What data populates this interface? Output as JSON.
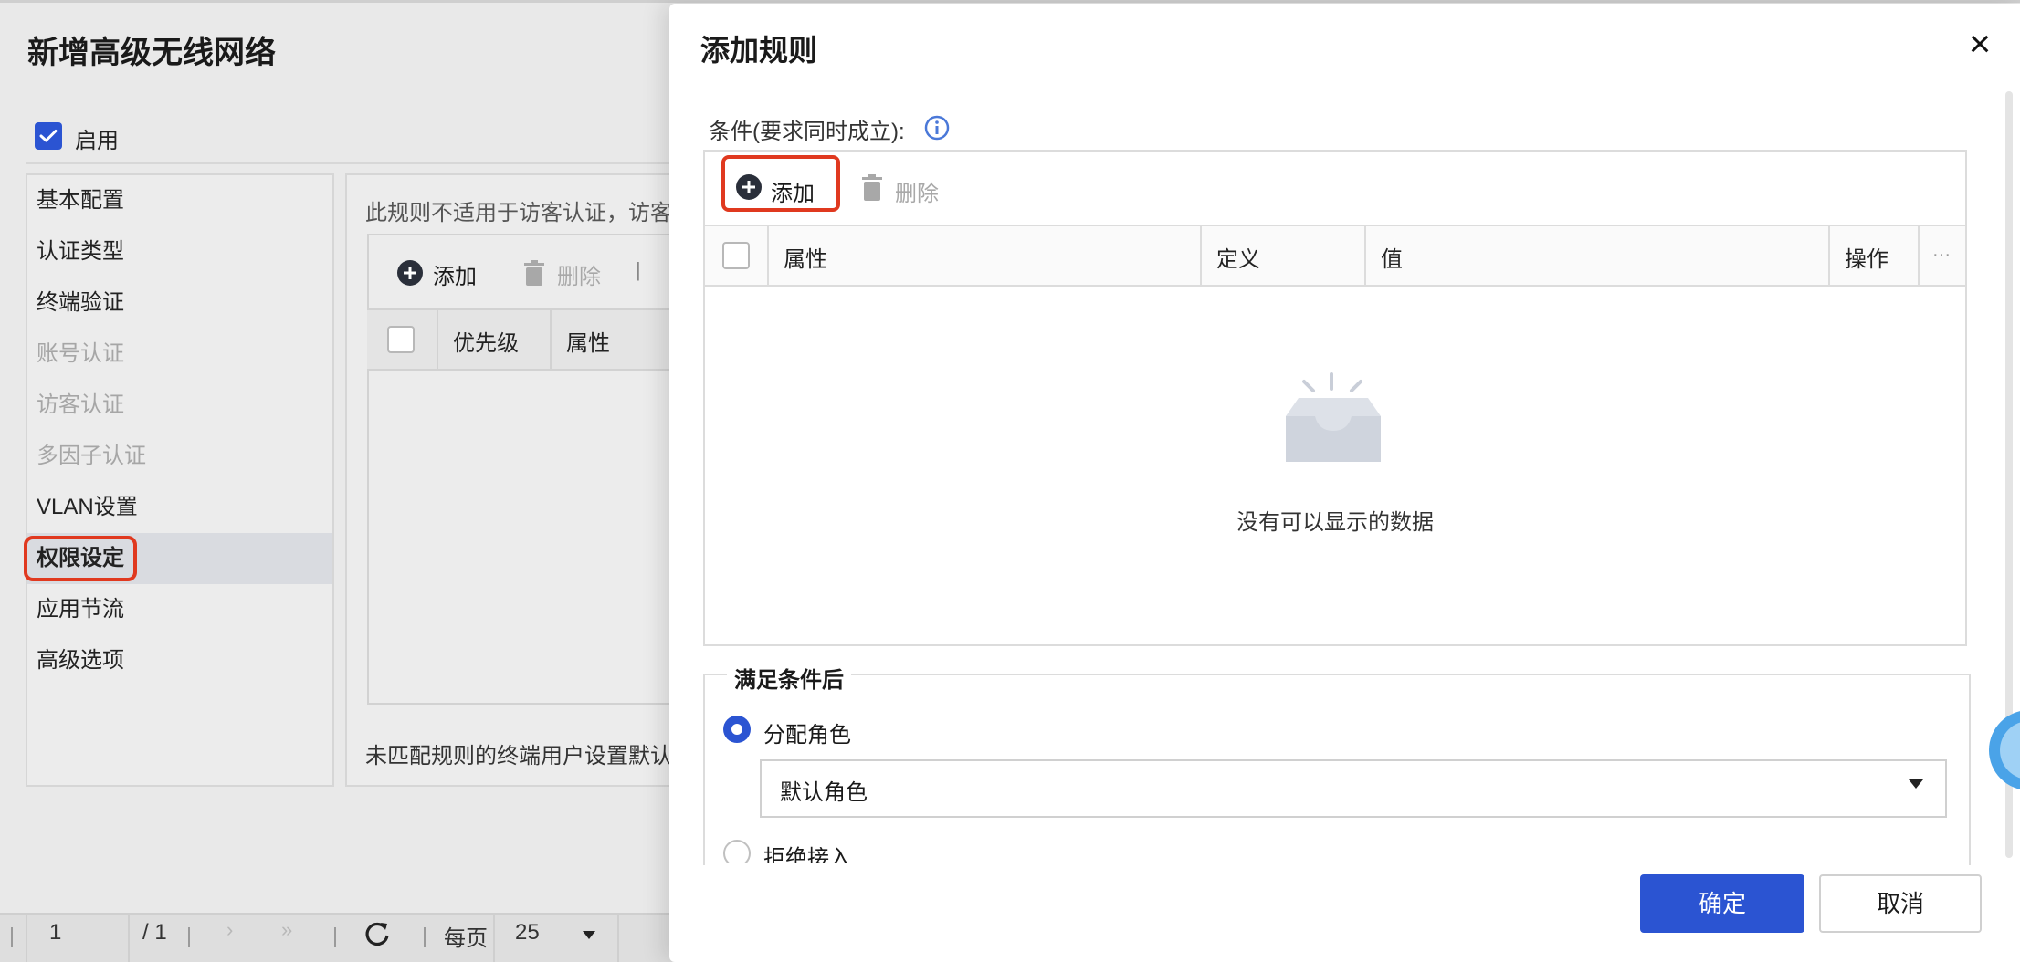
{
  "background_page": {
    "title": "新增高级无线网络",
    "enable_label": "启用",
    "nav": [
      {
        "label": "基本配置",
        "state": "normal"
      },
      {
        "label": "认证类型",
        "state": "normal"
      },
      {
        "label": "终端验证",
        "state": "normal"
      },
      {
        "label": "账号认证",
        "state": "disabled"
      },
      {
        "label": "访客认证",
        "state": "disabled"
      },
      {
        "label": "多因子认证",
        "state": "disabled"
      },
      {
        "label": "VLAN设置",
        "state": "normal"
      },
      {
        "label": "权限设定",
        "state": "active"
      },
      {
        "label": "应用节流",
        "state": "normal"
      },
      {
        "label": "高级选项",
        "state": "normal"
      }
    ],
    "content_note": "此规则不适用于访客认证，访客",
    "toolbar": {
      "add": "添加",
      "delete": "删除",
      "separator": "|"
    },
    "table_headers": [
      "优先级",
      "属性"
    ],
    "footer_note": "未匹配规则的终端用户设置默认",
    "pager": {
      "page": "1",
      "total": "/ 1",
      "per_page_label": "每页",
      "per_page_value": "25"
    }
  },
  "dialog": {
    "title": "添加规则",
    "close_icon": "close-icon",
    "conditions_label": "条件(要求同时成立):",
    "toolbar": {
      "add": "添加",
      "delete": "删除"
    },
    "table_headers": [
      "属性",
      "定义",
      "值",
      "操作",
      "···"
    ],
    "empty_text": "没有可以显示的数据",
    "after_section": {
      "legend": "满足条件后",
      "options": [
        {
          "label": "分配角色",
          "selected": true
        },
        {
          "label": "拒绝接入",
          "selected": false
        }
      ],
      "role_select_value": "默认角色"
    },
    "confirm": "确定",
    "cancel": "取消"
  },
  "colors": {
    "primary": "#2b54d2",
    "highlight": "#e0391f"
  }
}
